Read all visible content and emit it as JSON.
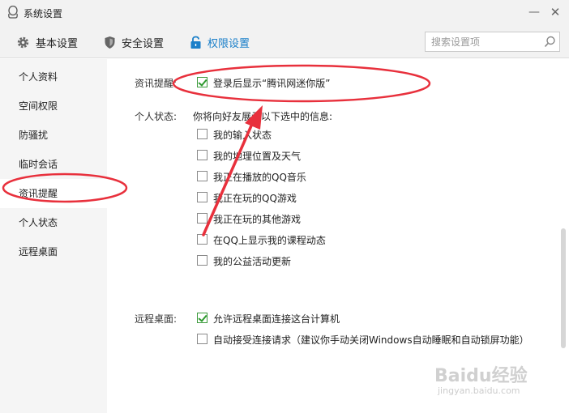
{
  "window": {
    "title": "系统设置",
    "minimize": "—",
    "close": "✕"
  },
  "toolbar": {
    "tabs": [
      {
        "label": "基本设置",
        "icon": "gear-icon"
      },
      {
        "label": "安全设置",
        "icon": "shield-icon"
      },
      {
        "label": "权限设置",
        "icon": "lock-icon",
        "active": true
      }
    ],
    "search_placeholder": "搜索设置项"
  },
  "sidebar": {
    "items": [
      {
        "label": "个人资料"
      },
      {
        "label": "空间权限"
      },
      {
        "label": "防骚扰"
      },
      {
        "label": "临时会话"
      },
      {
        "label": "资讯提醒",
        "active": true
      },
      {
        "label": "个人状态"
      },
      {
        "label": "远程桌面"
      }
    ]
  },
  "sections": {
    "news": {
      "label": "资讯提醒:",
      "options": [
        {
          "label": "登录后显示“腾讯网迷你版”",
          "checked": true
        }
      ]
    },
    "status": {
      "label": "个人状态:",
      "description": "你将向好友展示以下选中的信息:",
      "options": [
        {
          "label": "我的输入状态",
          "checked": false
        },
        {
          "label": "我的地理位置及天气",
          "checked": false
        },
        {
          "label": "我正在播放的QQ音乐",
          "checked": false
        },
        {
          "label": "我正在玩的QQ游戏",
          "checked": false
        },
        {
          "label": "我正在玩的其他游戏",
          "checked": false
        },
        {
          "label": "在QQ上显示我的课程动态",
          "checked": false
        },
        {
          "label": "我的公益活动更新",
          "checked": false
        }
      ]
    },
    "remote": {
      "label": "远程桌面:",
      "options": [
        {
          "label": "允许远程桌面连接这台计算机",
          "checked": true
        },
        {
          "label": "自动接受连接请求（建议你手动关闭Windows自动睡眠和自动锁屏功能）",
          "checked": false
        }
      ]
    }
  },
  "watermark": {
    "text": "Baidu经验",
    "sub": "jingyan.baidu.com"
  },
  "colors": {
    "accent": "#1a7fc9",
    "annotation": "#e8303c",
    "check": "#2e9a2e"
  }
}
